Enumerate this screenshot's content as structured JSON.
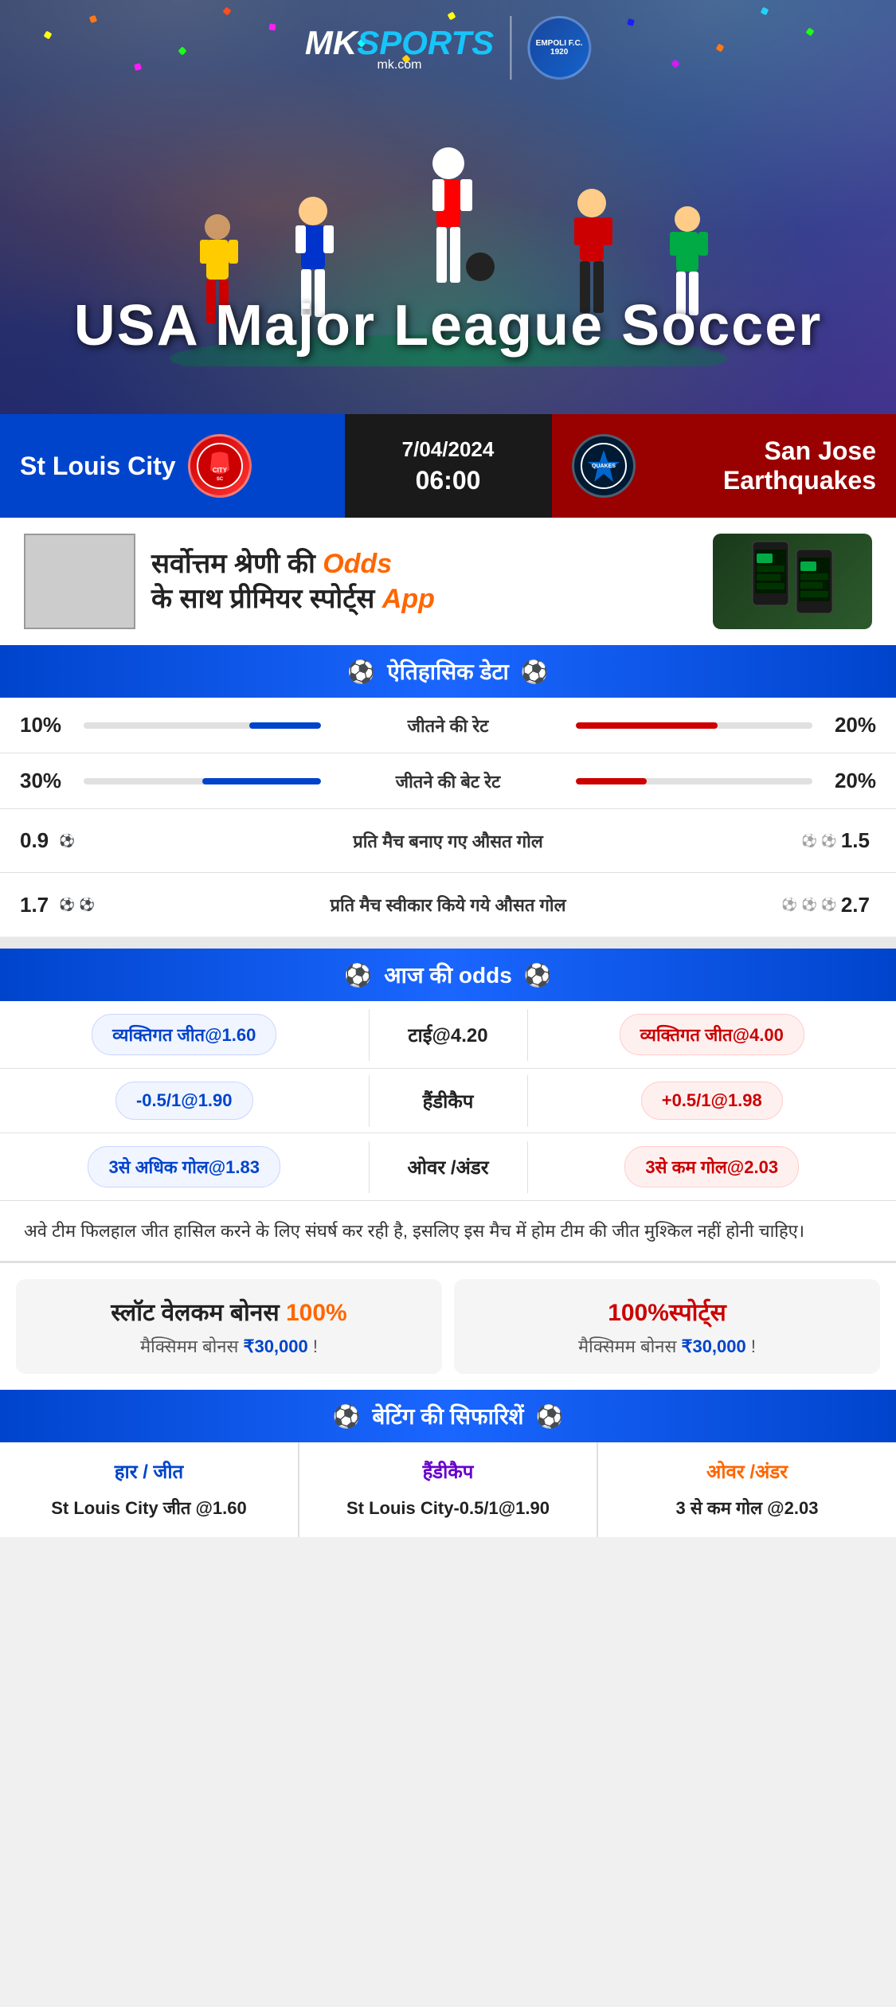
{
  "hero": {
    "title": "USA Major League Soccer",
    "logo_mk": "MK",
    "logo_sports": "SPORTS",
    "logo_url": "mk.com",
    "empoli_label": "EMPOLI F.C.\n1920"
  },
  "match": {
    "home_team": "St Louis City",
    "away_team": "San Jose Earthquakes",
    "date": "7/04/2024",
    "time": "06:00",
    "home_logo": "CITY SC",
    "away_logo": "QUAKES"
  },
  "promo": {
    "text_part1": "सर्वोत्तम श्रेणी की ",
    "text_highlight": "Odds",
    "text_part2": " के साथ प्रीमियर स्पोर्ट्स ",
    "text_app": "App"
  },
  "historical_section": {
    "title": "ऐतिहासिक डेटा",
    "rows": [
      {
        "left_val": "10%",
        "label": "जीतने की रेट",
        "right_val": "20%",
        "left_pct": 30,
        "right_pct": 60
      },
      {
        "left_val": "30%",
        "label": "जीतने की बेट रेट",
        "right_val": "20%",
        "left_pct": 50,
        "right_pct": 30
      }
    ],
    "goal_rows": [
      {
        "left_val": "0.9",
        "left_balls": 1,
        "label": "प्रति मैच बनाए गए औसत गोल",
        "right_val": "1.5",
        "right_balls": 2
      },
      {
        "left_val": "1.7",
        "left_balls": 2,
        "label": "प्रति मैच स्वीकार किये गये औसत गोल",
        "right_val": "2.7",
        "right_balls": 3
      }
    ]
  },
  "odds_section": {
    "title": "आज की odds",
    "rows": [
      {
        "left": "व्यक्तिगत जीत@1.60",
        "center": "टाई@4.20",
        "right": "व्यक्तिगत जीत@4.00"
      },
      {
        "left": "-0.5/1@1.90",
        "center": "हैंडीकैप",
        "right": "+0.5/1@1.98"
      },
      {
        "left": "3से अधिक गोल@1.83",
        "center": "ओवर /अंडर",
        "right": "3से कम गोल@2.03"
      }
    ]
  },
  "analysis": {
    "text": "अवे टीम फिलहाल जीत हासिल करने के लिए संघर्ष कर रही है, इसलिए इस मैच में होम टीम की जीत मुश्किल नहीं होनी चाहिए।"
  },
  "bonus": {
    "left_title": "स्लॉट वेलकम बोनस 100%",
    "left_subtitle": "मैक्सिमम बोनस ₹30,000  !",
    "right_title": "100%स्पोर्ट्स",
    "right_subtitle": "मैक्सिमम बोनस  ₹30,000 !"
  },
  "betting_recommendations": {
    "title": "बेटिंग की सिफारिशें",
    "cols": [
      {
        "type": "हार / जीत",
        "value": "St Louis City जीत @1.60",
        "color": "blue"
      },
      {
        "type": "हैंडीकैप",
        "value": "St Louis City-0.5/1@1.90",
        "color": "purple"
      },
      {
        "type": "ओवर /अंडर",
        "value": "3 से कम गोल @2.03",
        "color": "orange"
      }
    ]
  }
}
